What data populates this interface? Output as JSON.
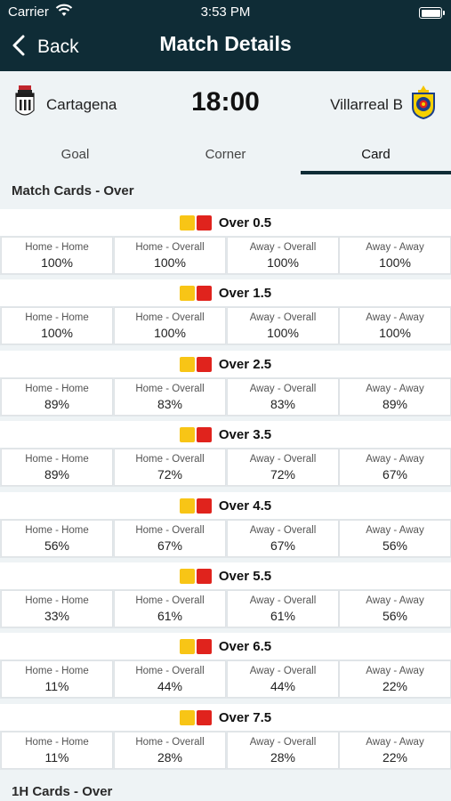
{
  "status_bar": {
    "carrier": "Carrier",
    "time": "3:53 PM"
  },
  "nav": {
    "back_label": "Back",
    "title": "Match Details"
  },
  "match": {
    "home_team": "Cartagena",
    "away_team": "Villarreal B",
    "kickoff": "18:00"
  },
  "tabs": [
    {
      "label": "Goal",
      "active": false
    },
    {
      "label": "Corner",
      "active": false
    },
    {
      "label": "Card",
      "active": true
    }
  ],
  "sections": {
    "match_cards_title": "Match Cards - Over",
    "first_half_title": "1H Cards - Over"
  },
  "columns": [
    "Home - Home",
    "Home - Overall",
    "Away - Overall",
    "Away - Away"
  ],
  "rows": [
    {
      "label": "Over 0.5",
      "values": [
        "100%",
        "100%",
        "100%",
        "100%"
      ]
    },
    {
      "label": "Over 1.5",
      "values": [
        "100%",
        "100%",
        "100%",
        "100%"
      ]
    },
    {
      "label": "Over 2.5",
      "values": [
        "89%",
        "83%",
        "83%",
        "89%"
      ]
    },
    {
      "label": "Over 3.5",
      "values": [
        "89%",
        "72%",
        "72%",
        "67%"
      ]
    },
    {
      "label": "Over 4.5",
      "values": [
        "56%",
        "67%",
        "67%",
        "56%"
      ]
    },
    {
      "label": "Over 5.5",
      "values": [
        "33%",
        "61%",
        "61%",
        "56%"
      ]
    },
    {
      "label": "Over 6.5",
      "values": [
        "11%",
        "44%",
        "44%",
        "22%"
      ]
    },
    {
      "label": "Over 7.5",
      "values": [
        "11%",
        "28%",
        "28%",
        "22%"
      ]
    }
  ],
  "colors": {
    "header_bg": "#0f2c36",
    "yellow_card": "#f8c516",
    "red_card": "#e0231d"
  }
}
